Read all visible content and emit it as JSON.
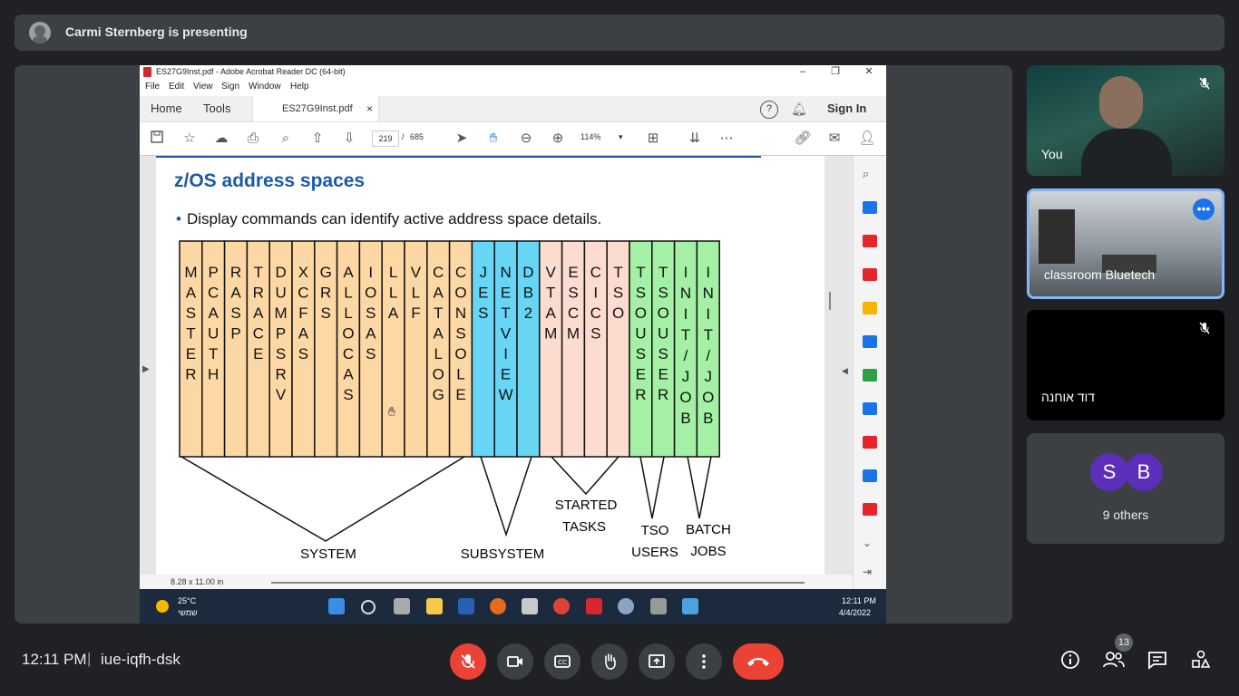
{
  "banner": {
    "presenter_text": "Carmi Sternberg is presenting"
  },
  "acrobat": {
    "window_title": "ES27G9Inst.pdf - Adobe Acrobat Reader DC (64-bit)",
    "menu": [
      "File",
      "Edit",
      "View",
      "Sign",
      "Window",
      "Help"
    ],
    "tabs": {
      "home": "Home",
      "tools": "Tools",
      "doc": "ES27G9Inst.pdf",
      "close": "×",
      "sign_in": "Sign In"
    },
    "page_current": "219",
    "page_sep": "/",
    "page_total": "685",
    "zoom": "114%",
    "page_size": "8.28 x 11.00 in"
  },
  "slide": {
    "title": "z/OS address spaces",
    "bullet": "Display commands can identify active address space details.",
    "columns": [
      {
        "label": "MASTER",
        "color": "#fdd8a4"
      },
      {
        "label": "PCAUTH",
        "color": "#fdd8a4"
      },
      {
        "label": "RASP",
        "color": "#fdd8a4"
      },
      {
        "label": "TRACE",
        "color": "#fdd8a4"
      },
      {
        "label": "DUMPSRV",
        "color": "#fdd8a4"
      },
      {
        "label": "XCFAS",
        "color": "#fdd8a4"
      },
      {
        "label": "GRS",
        "color": "#fdd8a4"
      },
      {
        "label": "ALLOCAS",
        "color": "#fdd8a4"
      },
      {
        "label": "IOSAS",
        "color": "#fdd8a4"
      },
      {
        "label": "LLA",
        "color": "#fdd8a4"
      },
      {
        "label": "VLF",
        "color": "#fdd8a4"
      },
      {
        "label": "CATALOG",
        "color": "#fdd8a4"
      },
      {
        "label": "CONSOLE",
        "color": "#fdd8a4"
      },
      {
        "label": "JES",
        "color": "#67d6f5"
      },
      {
        "label": "NETVIEW",
        "color": "#67d6f5"
      },
      {
        "label": "DB2",
        "color": "#67d6f5"
      },
      {
        "label": "VTAM",
        "color": "#fcdccf"
      },
      {
        "label": "ESCM",
        "color": "#fcdccf"
      },
      {
        "label": "CICS",
        "color": "#fcdccf"
      },
      {
        "label": "TSO",
        "color": "#fcdccf"
      },
      {
        "label": "TSO USER",
        "color": "#a4f0a4"
      },
      {
        "label": "TSO USER",
        "color": "#a4f0a4"
      },
      {
        "label": "INIT/JOB",
        "color": "#a4f0a4"
      },
      {
        "label": "INIT/JOB",
        "color": "#a4f0a4"
      }
    ],
    "groups": {
      "system": "SYSTEM",
      "subsystem": "SUBSYSTEM",
      "started_1": "STARTED",
      "started_2": "TASKS",
      "tso_1": "TSO",
      "tso_2": "USERS",
      "batch_1": "BATCH",
      "batch_2": "JOBS"
    }
  },
  "taskbar": {
    "temperature": "25°C",
    "weather": "שמשי",
    "time": "12:11 PM",
    "date": "4/4/2022"
  },
  "participants": [
    {
      "name": "You",
      "muted": true
    },
    {
      "name": "classroom Bluetech",
      "muted": false
    },
    {
      "name": "דוד אוחנה",
      "muted": true
    }
  ],
  "others": {
    "initials": [
      "S",
      "B"
    ],
    "label": "9 others"
  },
  "bottom_bar": {
    "time": "12:11 PM",
    "separator": "|",
    "meeting_code": "iue-iqfh-dsk",
    "participant_count": "13"
  },
  "colors": {
    "end_call": "#ea4335",
    "mic_off": "#ea4335",
    "accent": "#8ab4f8"
  }
}
